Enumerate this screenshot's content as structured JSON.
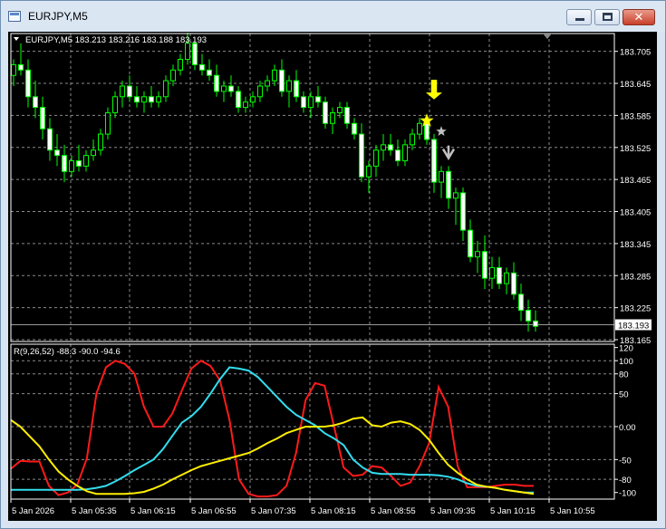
{
  "window": {
    "title": "EURJPY,M5",
    "icons": {
      "app": "chart-window-icon",
      "minimize": "minimize-icon",
      "maximize": "maximize-icon",
      "close": "close-icon"
    },
    "close_glyph": "✕"
  },
  "main_chart": {
    "legend_symbol": "EURJPY,M5",
    "ohlc": "183.213 183.216 183.188 183.193",
    "current_price": "183.193",
    "price_labels": [
      "183.705",
      "183.645",
      "183.585",
      "183.525",
      "183.465",
      "183.405",
      "183.345",
      "183.285",
      "183.225",
      "183.165"
    ],
    "colors": {
      "background": "#000000",
      "grid": "#8a8a8a",
      "candle": "#00ff00",
      "bull_body": "#000000",
      "bear_body": "#ffffff",
      "text": "#ffffff",
      "signal_yellow": "#ffff00",
      "signal_gray": "#c0c0c0"
    }
  },
  "indicator": {
    "legend": "R(9,26,52) -88.3 -90.0 -94.6",
    "scale_labels": [
      "120",
      "100",
      "80",
      "50",
      "0.00",
      "-50",
      "-80",
      "-100"
    ],
    "colors": {
      "red": "#ff1a1a",
      "cyan": "#33ddee",
      "yellow": "#ffee00"
    }
  },
  "time_axis": {
    "labels": [
      "5 Jan 2026",
      "5 Jan 05:35",
      "5 Jan 06:15",
      "5 Jan 06:55",
      "5 Jan 07:35",
      "5 Jan 08:15",
      "5 Jan 08:55",
      "5 Jan 09:35",
      "5 Jan 10:15",
      "5 Jan 10:55"
    ]
  },
  "chart_data": [
    {
      "type": "candlestick",
      "title": "EURJPY,M5",
      "ylim": [
        183.165,
        183.735
      ],
      "last_price": 183.193,
      "candles": [
        [
          183.66,
          183.69,
          183.64,
          183.68
        ],
        [
          183.68,
          183.72,
          183.66,
          183.67
        ],
        [
          183.67,
          183.69,
          183.6,
          183.62
        ],
        [
          183.62,
          183.65,
          183.58,
          183.6
        ],
        [
          183.6,
          183.62,
          183.54,
          183.56
        ],
        [
          183.56,
          183.58,
          183.5,
          183.52
        ],
        [
          183.52,
          183.55,
          183.49,
          183.51
        ],
        [
          183.51,
          183.53,
          183.46,
          183.48
        ],
        [
          183.48,
          183.51,
          183.47,
          183.5
        ],
        [
          183.5,
          183.53,
          183.48,
          183.49
        ],
        [
          183.49,
          183.52,
          183.48,
          183.51
        ],
        [
          183.51,
          183.54,
          183.5,
          183.52
        ],
        [
          183.52,
          183.56,
          183.51,
          183.55
        ],
        [
          183.55,
          183.6,
          183.54,
          183.59
        ],
        [
          183.59,
          183.63,
          183.58,
          183.62
        ],
        [
          183.62,
          183.65,
          183.6,
          183.64
        ],
        [
          183.64,
          183.66,
          183.61,
          183.62
        ],
        [
          183.62,
          183.64,
          183.6,
          183.61
        ],
        [
          183.61,
          183.63,
          183.59,
          183.62
        ],
        [
          183.62,
          183.64,
          183.6,
          183.61
        ],
        [
          183.61,
          183.63,
          183.6,
          183.62
        ],
        [
          183.62,
          183.66,
          183.61,
          183.65
        ],
        [
          183.65,
          183.68,
          183.64,
          183.67
        ],
        [
          183.67,
          183.7,
          183.66,
          183.69
        ],
        [
          183.69,
          183.74,
          183.68,
          183.72
        ],
        [
          183.72,
          183.73,
          183.67,
          183.68
        ],
        [
          183.68,
          183.7,
          183.66,
          183.67
        ],
        [
          183.67,
          183.69,
          183.65,
          183.66
        ],
        [
          183.66,
          183.68,
          183.62,
          183.63
        ],
        [
          183.63,
          183.65,
          183.61,
          183.64
        ],
        [
          183.64,
          183.66,
          183.62,
          183.63
        ],
        [
          183.63,
          183.64,
          183.59,
          183.6
        ],
        [
          183.6,
          183.62,
          183.59,
          183.61
        ],
        [
          183.61,
          183.63,
          183.6,
          183.62
        ],
        [
          183.62,
          183.65,
          183.61,
          183.64
        ],
        [
          183.64,
          183.66,
          183.63,
          183.65
        ],
        [
          183.65,
          183.68,
          183.64,
          183.67
        ],
        [
          183.67,
          183.69,
          183.62,
          183.63
        ],
        [
          183.63,
          183.66,
          183.6,
          183.65
        ],
        [
          183.65,
          183.67,
          183.61,
          183.62
        ],
        [
          183.62,
          183.63,
          183.59,
          183.6
        ],
        [
          183.6,
          183.63,
          183.58,
          183.62
        ],
        [
          183.62,
          183.64,
          183.6,
          183.61
        ],
        [
          183.61,
          183.62,
          183.56,
          183.57
        ],
        [
          183.57,
          183.6,
          183.55,
          183.59
        ],
        [
          183.59,
          183.61,
          183.58,
          183.6
        ],
        [
          183.6,
          183.61,
          183.56,
          183.57
        ],
        [
          183.57,
          183.58,
          183.54,
          183.55
        ],
        [
          183.55,
          183.57,
          183.46,
          183.47
        ],
        [
          183.47,
          183.5,
          183.44,
          183.49
        ],
        [
          183.49,
          183.53,
          183.47,
          183.52
        ],
        [
          183.52,
          183.55,
          183.5,
          183.53
        ],
        [
          183.53,
          183.55,
          183.51,
          183.52
        ],
        [
          183.52,
          183.54,
          183.49,
          183.5
        ],
        [
          183.5,
          183.54,
          183.49,
          183.53
        ],
        [
          183.53,
          183.56,
          183.52,
          183.55
        ],
        [
          183.55,
          183.58,
          183.54,
          183.57
        ],
        [
          183.57,
          183.58,
          183.53,
          183.54
        ],
        [
          183.54,
          183.55,
          183.44,
          183.46
        ],
        [
          183.46,
          183.49,
          183.43,
          183.48
        ],
        [
          183.48,
          183.49,
          183.41,
          183.43
        ],
        [
          183.43,
          183.45,
          183.38,
          183.44
        ],
        [
          183.44,
          183.45,
          183.35,
          183.37
        ],
        [
          183.37,
          183.39,
          183.31,
          183.32
        ],
        [
          183.32,
          183.35,
          183.29,
          183.33
        ],
        [
          183.33,
          183.36,
          183.26,
          183.28
        ],
        [
          183.28,
          183.32,
          183.26,
          183.3
        ],
        [
          183.3,
          183.32,
          183.26,
          183.27
        ],
        [
          183.27,
          183.3,
          183.25,
          183.29
        ],
        [
          183.29,
          183.31,
          183.24,
          183.25
        ],
        [
          183.25,
          183.27,
          183.2,
          183.22
        ],
        [
          183.22,
          183.24,
          183.18,
          183.2
        ],
        [
          183.2,
          183.22,
          183.18,
          183.19
        ]
      ],
      "signals": [
        {
          "kind": "arrow-down",
          "color": "yellow",
          "index": 58,
          "price": 183.615
        },
        {
          "kind": "star",
          "color": "yellow",
          "index": 57,
          "price": 183.575
        },
        {
          "kind": "star",
          "color": "gray",
          "index": 59,
          "price": 183.555
        },
        {
          "kind": "arrow-down",
          "color": "gray",
          "index": 60,
          "price": 183.505
        }
      ]
    },
    {
      "type": "line",
      "title": "R(9,26,52)",
      "ylim": [
        -110,
        125
      ],
      "series": [
        {
          "color": "red",
          "values": [
            -64,
            -52,
            -53,
            -53,
            -90,
            -104,
            -100,
            -88,
            -48,
            50,
            90,
            100,
            95,
            80,
            30,
            0,
            0,
            20,
            55,
            88,
            100,
            92,
            70,
            10,
            -80,
            -102,
            -106,
            -106,
            -104,
            -90,
            -40,
            40,
            66,
            62,
            0,
            -62,
            -75,
            -73,
            -60,
            -62,
            -75,
            -90,
            -85,
            -60,
            -25,
            60,
            30,
            -60,
            -92,
            -92,
            -92,
            -90,
            -88,
            -88,
            -90,
            -90
          ]
        },
        {
          "color": "cyan",
          "values": [
            -96,
            -96,
            -96,
            -96,
            -96,
            -96,
            -96,
            -96,
            -95,
            -93,
            -90,
            -83,
            -75,
            -66,
            -58,
            -50,
            -34,
            -14,
            6,
            16,
            30,
            50,
            72,
            90,
            88,
            85,
            75,
            60,
            45,
            30,
            18,
            10,
            2,
            -10,
            -18,
            -28,
            -50,
            -62,
            -70,
            -72,
            -72,
            -72,
            -73,
            -73,
            -73,
            -74,
            -76,
            -80,
            -86,
            -90,
            -91,
            -93,
            -96,
            -98,
            -100,
            -100
          ]
        },
        {
          "color": "yellow",
          "values": [
            10,
            0,
            -15,
            -30,
            -50,
            -68,
            -80,
            -90,
            -98,
            -102,
            -102,
            -102,
            -102,
            -101,
            -99,
            -94,
            -88,
            -80,
            -73,
            -66,
            -60,
            -56,
            -52,
            -48,
            -44,
            -40,
            -33,
            -25,
            -18,
            -10,
            -5,
            0,
            0,
            0,
            2,
            6,
            12,
            14,
            2,
            0,
            6,
            8,
            4,
            -5,
            -20,
            -40,
            -58,
            -70,
            -80,
            -88,
            -91,
            -93,
            -96,
            -98,
            -100,
            -102
          ]
        }
      ]
    }
  ]
}
